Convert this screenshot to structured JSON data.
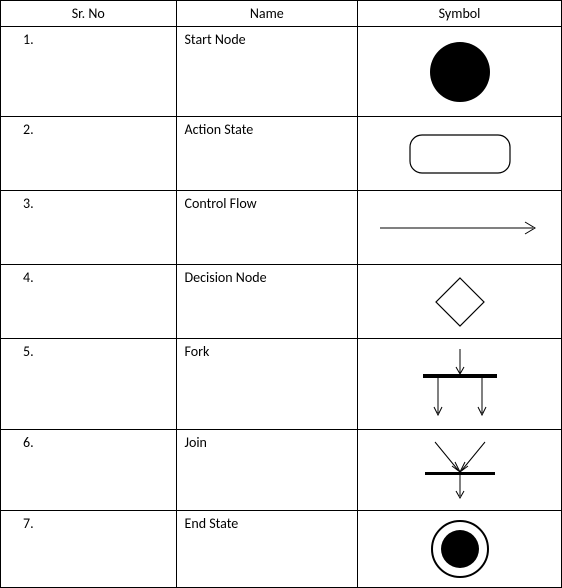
{
  "headers": {
    "sr": "Sr. No",
    "name": "Name",
    "symbol": "Symbol"
  },
  "rows": [
    {
      "sr": "1.",
      "name": "Start Node",
      "symbol": "start-node"
    },
    {
      "sr": "2.",
      "name": "Action State",
      "symbol": "action-state"
    },
    {
      "sr": "3.",
      "name": "Control Flow",
      "symbol": "control-flow"
    },
    {
      "sr": "4.",
      "name": "Decision Node",
      "symbol": "decision-node"
    },
    {
      "sr": "5.",
      "name": "Fork",
      "symbol": "fork"
    },
    {
      "sr": "6.",
      "name": "Join",
      "symbol": "join"
    },
    {
      "sr": "7.",
      "name": "End State",
      "symbol": "end-state"
    }
  ]
}
